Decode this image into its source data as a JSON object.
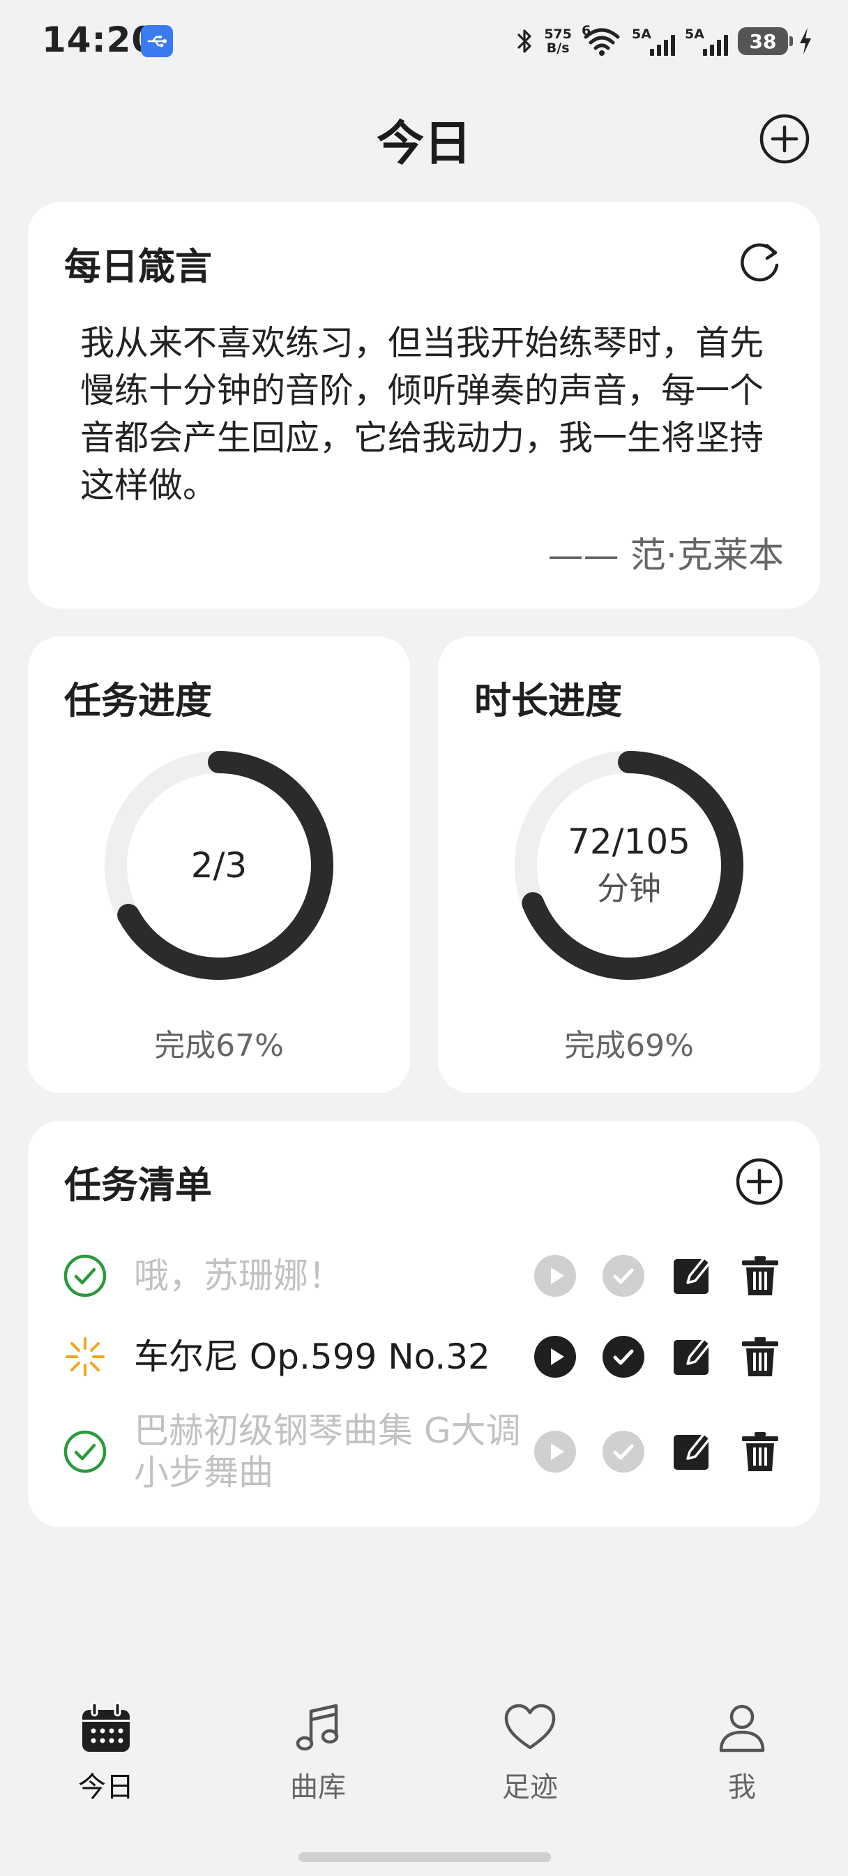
{
  "status_bar": {
    "time": "14:20",
    "net_speed_top": "575",
    "net_speed_bottom": "B/s",
    "wifi_badge": "6",
    "signal1_label": "5A",
    "signal2_label": "5A",
    "battery": "38",
    "icons": [
      "usb-icon",
      "bluetooth-icon",
      "wifi-icon",
      "signal-icon",
      "battery-icon",
      "charging-icon"
    ]
  },
  "header": {
    "title": "今日",
    "add_icon": "plus-circle-icon"
  },
  "quote": {
    "title": "每日箴言",
    "text": "我从来不喜欢练习，但当我开始练琴时，首先慢练十分钟的音阶，倾听弹奏的声音，每一个音都会产生回应，它给我动力，我一生将坚持这样做。",
    "author": "—— 范·克莱本",
    "refresh_icon": "refresh-icon"
  },
  "task_progress": {
    "title": "任务进度",
    "value": "2/3",
    "caption": "完成67%",
    "fraction": 0.67
  },
  "duration_progress": {
    "title": "时长进度",
    "value": "72/105",
    "unit": "分钟",
    "caption": "完成69%",
    "fraction": 0.69
  },
  "tasks": {
    "title": "任务清单",
    "add_icon": "plus-circle-icon",
    "items": [
      {
        "name": "哦，苏珊娜！",
        "status": "done"
      },
      {
        "name": "车尔尼 Op.599 No.32",
        "status": "in-progress"
      },
      {
        "name": "巴赫初级钢琴曲集 G大调小步舞曲",
        "status": "done"
      }
    ]
  },
  "nav": {
    "items": [
      {
        "label": "今日",
        "icon": "calendar-icon",
        "active": true
      },
      {
        "label": "曲库",
        "icon": "music-note-icon",
        "active": false
      },
      {
        "label": "足迹",
        "icon": "heart-icon",
        "active": false
      },
      {
        "label": "我",
        "icon": "person-icon",
        "active": false
      }
    ]
  },
  "colors": {
    "background": "#f1f2f4",
    "card": "#ffffff",
    "ring_track": "#efefef",
    "ring_fill": "#2b2b2b",
    "done_green": "#2a9a3a",
    "in_progress_orange": "#f5a21b",
    "disabled_gray": "#d0d0d0"
  }
}
